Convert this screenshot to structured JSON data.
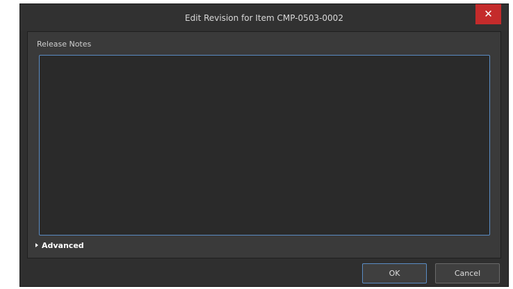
{
  "dialog": {
    "title": "Edit Revision for Item CMP-0503-0002",
    "close_glyph": "✕"
  },
  "release_notes": {
    "label": "Release Notes",
    "value": ""
  },
  "advanced": {
    "label": "Advanced"
  },
  "buttons": {
    "ok_label": "OK",
    "cancel_label": "Cancel"
  },
  "colors": {
    "close_button": "#c42b2b",
    "focus_border": "#5a8cc4"
  }
}
